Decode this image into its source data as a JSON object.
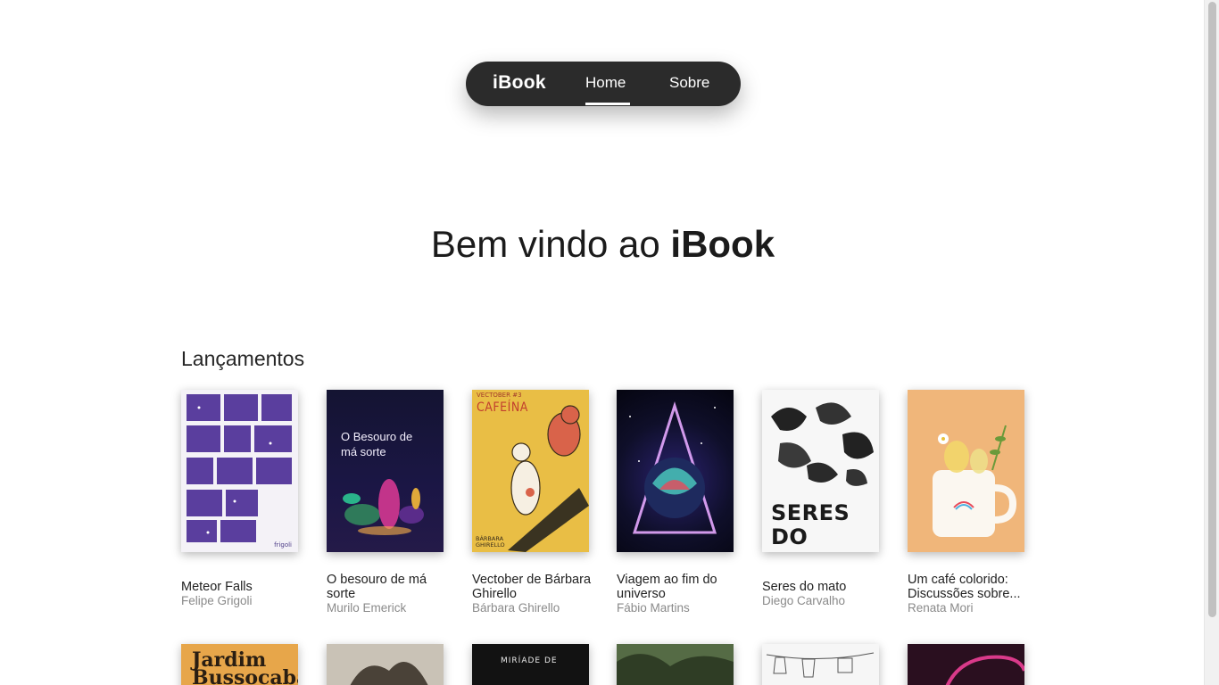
{
  "nav": {
    "logo": "iBook",
    "links": [
      {
        "label": "Home",
        "active": true
      },
      {
        "label": "Sobre",
        "active": false
      }
    ]
  },
  "hero": {
    "prefix": "Bem vindo ao ",
    "brand": "iBook"
  },
  "section": {
    "title": "Lançamentos"
  },
  "books": [
    {
      "title": "Meteor Falls",
      "author": "Felipe Grigoli",
      "cover_text": "frigoli"
    },
    {
      "title": "O besouro de má sorte",
      "author": "Murilo Emerick",
      "cover_text": "O Besouro de má sorte"
    },
    {
      "title": "Vectober de Bárbara Ghirello",
      "author": "Bárbara Ghirello",
      "cover_text": "CAFEÍNA",
      "cover_header": "VECTOBER #3",
      "cover_footer": "BÁRBARA GHIRELLO"
    },
    {
      "title": "Viagem ao fim do universo",
      "author": "Fábio Martins"
    },
    {
      "title": "Seres do mato",
      "author": "Diego Carvalho",
      "cover_text": "SERES DO MATO"
    },
    {
      "title": "Um café colorido: Discussões sobre...",
      "author": "Renata Mori"
    }
  ],
  "second_row": [
    {
      "cover_text": "Jardim Bussocaba"
    },
    {
      "cover_text": ""
    },
    {
      "cover_text": "MIRÍADE DE"
    },
    {
      "cover_text": ""
    },
    {
      "cover_text": ""
    },
    {
      "cover_text": ""
    }
  ],
  "colors": {
    "nav_bg": "#2b2b2b",
    "accent_white": "#ffffff",
    "author_gray": "#8a8a8a"
  }
}
